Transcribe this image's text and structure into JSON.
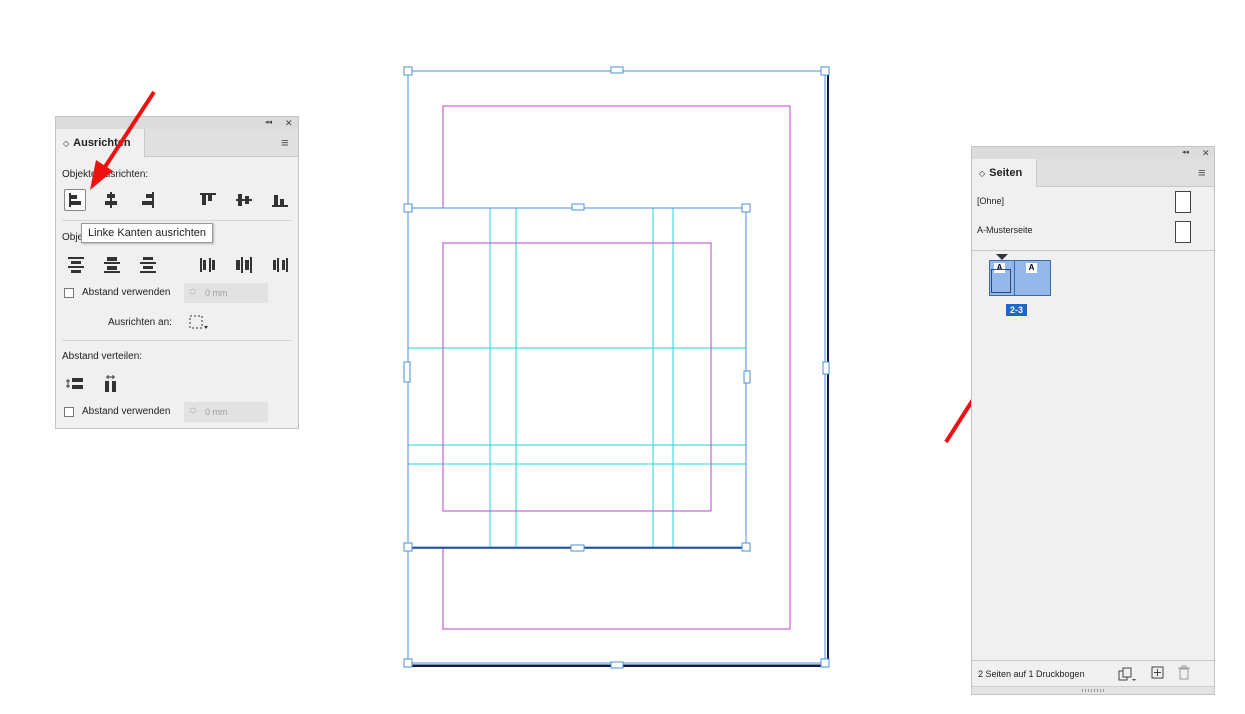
{
  "align_panel": {
    "tab_label": "Ausrichten",
    "align_objects_title": "Objekte ausrichten:",
    "distribute_objects_title": "Objekte verteilen:",
    "use_spacing_label": "Abstand verwenden",
    "spacing_value": "0 mm",
    "align_to_label": "Ausrichten an:",
    "distribute_spacing_title": "Abstand verteilen:",
    "use_spacing_label_2": "Abstand verwenden",
    "spacing_value_2": "0 mm",
    "tooltip": "Linke Kanten ausrichten",
    "collapse_glyph": "◂◂",
    "close_glyph": "✕",
    "menu_glyph": "≡",
    "icons": [
      "align-left-icon",
      "align-horizontal-center-icon",
      "align-right-icon",
      "align-top-icon",
      "align-vertical-center-icon",
      "align-bottom-icon",
      "distribute-top-icon",
      "distribute-vertical-center-icon",
      "distribute-bottom-icon",
      "distribute-left-icon",
      "distribute-horizontal-center-icon",
      "distribute-right-icon",
      "align-to-selection-icon",
      "distribute-vertical-space-icon",
      "distribute-horizontal-space-icon"
    ]
  },
  "pages_panel": {
    "tab_label": "Seiten",
    "masters": [
      "[Ohne]",
      "A-Musterseite"
    ],
    "spread_letters": [
      "A",
      "A"
    ],
    "spread_label": "2-3",
    "status": "2 Seiten auf 1 Druckbogen",
    "collapse_glyph": "◂◂",
    "close_glyph": "✕",
    "menu_glyph": "≡",
    "icons": [
      "page-size-icon",
      "new-page-icon",
      "delete-page-icon"
    ]
  },
  "colors": {
    "selection": "#4a90d9",
    "margin_guides": "#c03fd0",
    "column_guides": "#20d6e6",
    "page_border": "#0a1a4a",
    "annotation_arrow": "#ee1111",
    "selected_spread": "#94b8ea",
    "page_badge": "#1f66c9"
  }
}
